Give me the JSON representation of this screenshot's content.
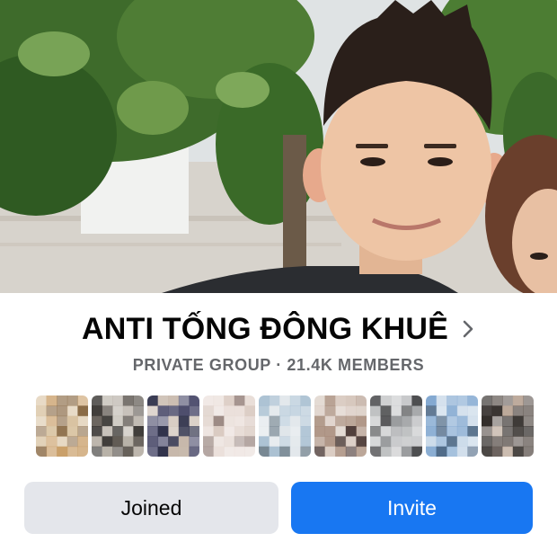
{
  "group": {
    "name": "ANTI TỐNG ĐÔNG KHUÊ",
    "privacy": "PRIVATE GROUP",
    "separator": "·",
    "members_count": "21.4K MEMBERS"
  },
  "cover_photo": {
    "description_icon": "cover-photo"
  },
  "member_avatars": [
    {
      "id": 1,
      "colors": [
        "#c79a61",
        "#8a6a45",
        "#d8c2a0"
      ]
    },
    {
      "id": 2,
      "colors": [
        "#5d5750",
        "#2c2926",
        "#b7b0a6"
      ]
    },
    {
      "id": 3,
      "colors": [
        "#2a2c45",
        "#c6b7aa",
        "#4a4a6a"
      ]
    },
    {
      "id": 4,
      "colors": [
        "#d9c9c0",
        "#9c8a84",
        "#e8dcd6"
      ]
    },
    {
      "id": 5,
      "colors": [
        "#a8bfd1",
        "#e0e6ea",
        "#6c7e8a"
      ]
    },
    {
      "id": 6,
      "colors": [
        "#4c3a36",
        "#a58977",
        "#d6c7bd"
      ]
    },
    {
      "id": 7,
      "colors": [
        "#8d8f92",
        "#3b3c3e",
        "#c7c8ca"
      ]
    },
    {
      "id": 8,
      "colors": [
        "#7fa6cf",
        "#c9d9e8",
        "#3c5a7a"
      ]
    },
    {
      "id": 9,
      "colors": [
        "#5e5550",
        "#b9a596",
        "#2f2a27"
      ]
    }
  ],
  "actions": {
    "joined_label": "Joined",
    "invite_label": "Invite"
  },
  "colors": {
    "primary_blue": "#1877f2",
    "secondary_gray": "#e4e6eb",
    "meta_text": "#65676b"
  }
}
